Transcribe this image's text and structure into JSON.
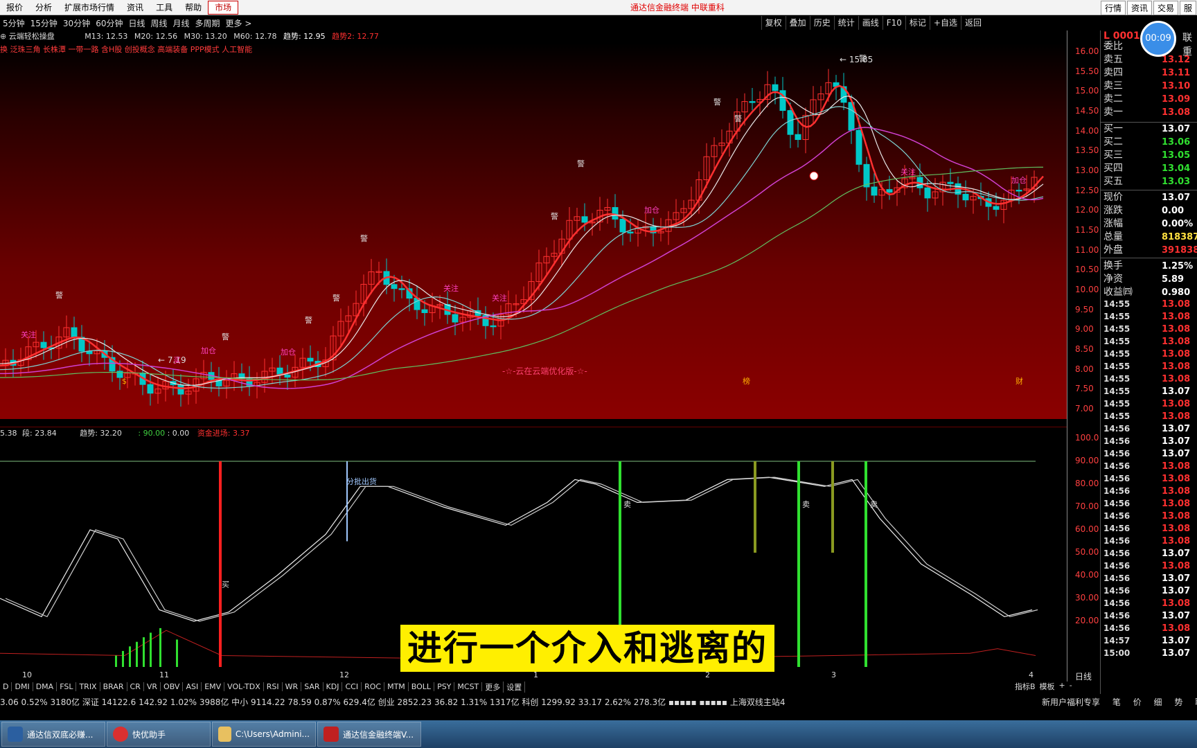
{
  "menu": {
    "items": [
      "报价",
      "分析",
      "扩展市场行情",
      "资讯",
      "工具",
      "帮助"
    ],
    "active": "市场",
    "center": "通达信金融终端  中联重科",
    "right": [
      "行情",
      "资讯",
      "交易",
      "服"
    ]
  },
  "periods": [
    "5分钟",
    "15分钟",
    "30分钟",
    "60分钟",
    "日线",
    "周线",
    "月线",
    "多周期",
    "更多 >"
  ],
  "tools": [
    "复权",
    "叠加",
    "历史",
    "统计",
    "画线",
    "F10",
    "标记",
    "+自选",
    "返回"
  ],
  "info": {
    "name": "云端轻松操盘",
    "m13": "M13: 12.53",
    "m20": "M20: 12.56",
    "m30": "M30: 13.20",
    "m60": "M60: 12.78",
    "trend1": "趋势: 12.95",
    "trend2": "趋势2: 12.77"
  },
  "concepts": "换 泛珠三角 长株潭 一带一路 含H股 创投概念 高端装备 PPP模式 人工智能",
  "price_axis": [
    "16.00",
    "15.50",
    "15.00",
    "14.50",
    "14.00",
    "13.50",
    "13.00",
    "12.50",
    "12.00",
    "11.50",
    "11.00",
    "10.50",
    "10.00",
    "9.50",
    "9.00",
    "8.50",
    "8.00",
    "7.50",
    "7.00"
  ],
  "annotations": {
    "high": "15.85",
    "low": "7.19",
    "watermark": "-☆-云在云端优化版-☆-"
  },
  "marks": [
    "关注",
    "加仓",
    "警",
    "卖出",
    "买"
  ],
  "bottom_markers": [
    "$",
    "榜",
    "财"
  ],
  "subinfo": {
    "a": "5.38",
    "b": "段: 23.84",
    "trend": "趋势: 32.20",
    "c": ": 90.00",
    "d": ": 0.00",
    "fund": "资金进场: 3.37"
  },
  "sub_axis": [
    "100.0",
    "90.00",
    "80.00",
    "70.00",
    "60.00",
    "50.00",
    "40.00",
    "30.00",
    "20.00"
  ],
  "sub_labels": {
    "batch": "分批出货",
    "sell": "卖",
    "buy": "买"
  },
  "x_axis": [
    "10",
    "11",
    "12",
    "1",
    "2",
    "3",
    "4"
  ],
  "x_right": "日线",
  "tabs": [
    "D",
    "DMI",
    "DMA",
    "FSL",
    "TRIX",
    "BRAR",
    "CR",
    "VR",
    "OBV",
    "ASI",
    "EMV",
    "VOL-TDX",
    "RSI",
    "WR",
    "SAR",
    "KDJ",
    "CCI",
    "ROC",
    "MTM",
    "BOLL",
    "PSY",
    "MCST",
    "更多",
    "设置"
  ],
  "tab_right": [
    "指标B",
    "模板",
    "+",
    "-"
  ],
  "index_bar": "3.06 0.52% 3180亿  深证 14122.6 142.92 1.02% 3988亿  中小 9114.22 78.59 0.87% 629.4亿  创业 2852.23 36.82 1.31% 1317亿  科创 1299.92 33.17 2.62% 278.3亿   ▪▪▪▪▪ ▪▪▪▪▪  上海双线主站4",
  "index_right": [
    "新用户福利专享",
    "笔",
    "价",
    "细",
    "势",
    "联"
  ],
  "subtitle": "进行一个介入和逃离的",
  "timer": "00:09",
  "right_panel": {
    "header": "L 0001",
    "header_right": "联重",
    "rows": [
      [
        "委比",
        ""
      ],
      [
        "卖五",
        "13.12"
      ],
      [
        "卖四",
        "13.11"
      ],
      [
        "卖三",
        "13.10"
      ],
      [
        "卖二",
        "13.09"
      ],
      [
        "卖一",
        "13.08"
      ],
      [
        "买一",
        "13.07"
      ],
      [
        "买二",
        "13.06"
      ],
      [
        "买三",
        "13.05"
      ],
      [
        "买四",
        "13.04"
      ],
      [
        "买五",
        "13.03"
      ],
      [
        "现价",
        "13.07"
      ],
      [
        "涨跌",
        "0.00"
      ],
      [
        "涨幅",
        "0.00%"
      ],
      [
        "总量",
        "818387"
      ],
      [
        "外盘",
        "391838"
      ],
      [
        "换手",
        "1.25%"
      ],
      [
        "净资",
        "5.89"
      ],
      [
        "收益㈣",
        "0.980"
      ]
    ],
    "ticks": [
      [
        "14:55",
        "13.08"
      ],
      [
        "14:55",
        "13.08"
      ],
      [
        "14:55",
        "13.08"
      ],
      [
        "14:55",
        "13.08"
      ],
      [
        "14:55",
        "13.08"
      ],
      [
        "14:55",
        "13.08"
      ],
      [
        "14:55",
        "13.08"
      ],
      [
        "14:55",
        "13.07"
      ],
      [
        "14:55",
        "13.08"
      ],
      [
        "14:55",
        "13.08"
      ],
      [
        "14:56",
        "13.07"
      ],
      [
        "14:56",
        "13.07"
      ],
      [
        "14:56",
        "13.07"
      ],
      [
        "14:56",
        "13.08"
      ],
      [
        "14:56",
        "13.08"
      ],
      [
        "14:56",
        "13.08"
      ],
      [
        "14:56",
        "13.08"
      ],
      [
        "14:56",
        "13.08"
      ],
      [
        "14:56",
        "13.08"
      ],
      [
        "14:56",
        "13.08"
      ],
      [
        "14:56",
        "13.07"
      ],
      [
        "14:56",
        "13.08"
      ],
      [
        "14:56",
        "13.07"
      ],
      [
        "14:56",
        "13.07"
      ],
      [
        "14:56",
        "13.08"
      ],
      [
        "14:56",
        "13.07"
      ],
      [
        "14:56",
        "13.08"
      ],
      [
        "14:57",
        "13.07"
      ],
      [
        "15:00",
        "13.07"
      ]
    ]
  },
  "taskbar": [
    "通达信双底必赚...",
    "快优助手",
    "C:\\Users\\Admini...",
    "通达信金融终端V..."
  ],
  "colors": {
    "up": "#ff3030",
    "down": "#00c8c8",
    "ma_white": "#e8e8e8",
    "ma_cyan": "#7fd4d4",
    "ma_magenta": "#d040d0",
    "ma_green": "#60c060"
  }
}
